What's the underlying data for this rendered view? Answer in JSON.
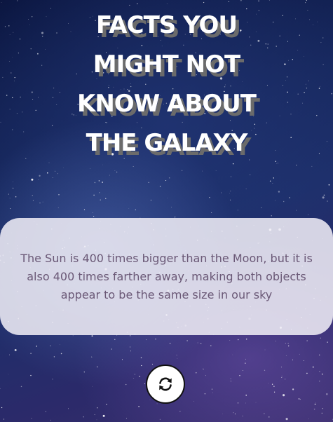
{
  "title": {
    "lines": [
      "FACTS YOU",
      "MIGHT NOT",
      "KNOW ABOUT",
      "THE GALAXY"
    ]
  },
  "fact": {
    "text": "The Sun is 400 times bigger than the Moon, but it is also 400 times farther away, making both objects appear to be the same size in our sky"
  },
  "refresh_button": {
    "icon": "refresh-icon"
  },
  "colors": {
    "title_text": "#ffffff",
    "title_shadow": "#6b6b6b",
    "fact_text": "#6a5876",
    "card_background": "#eeecf5"
  }
}
